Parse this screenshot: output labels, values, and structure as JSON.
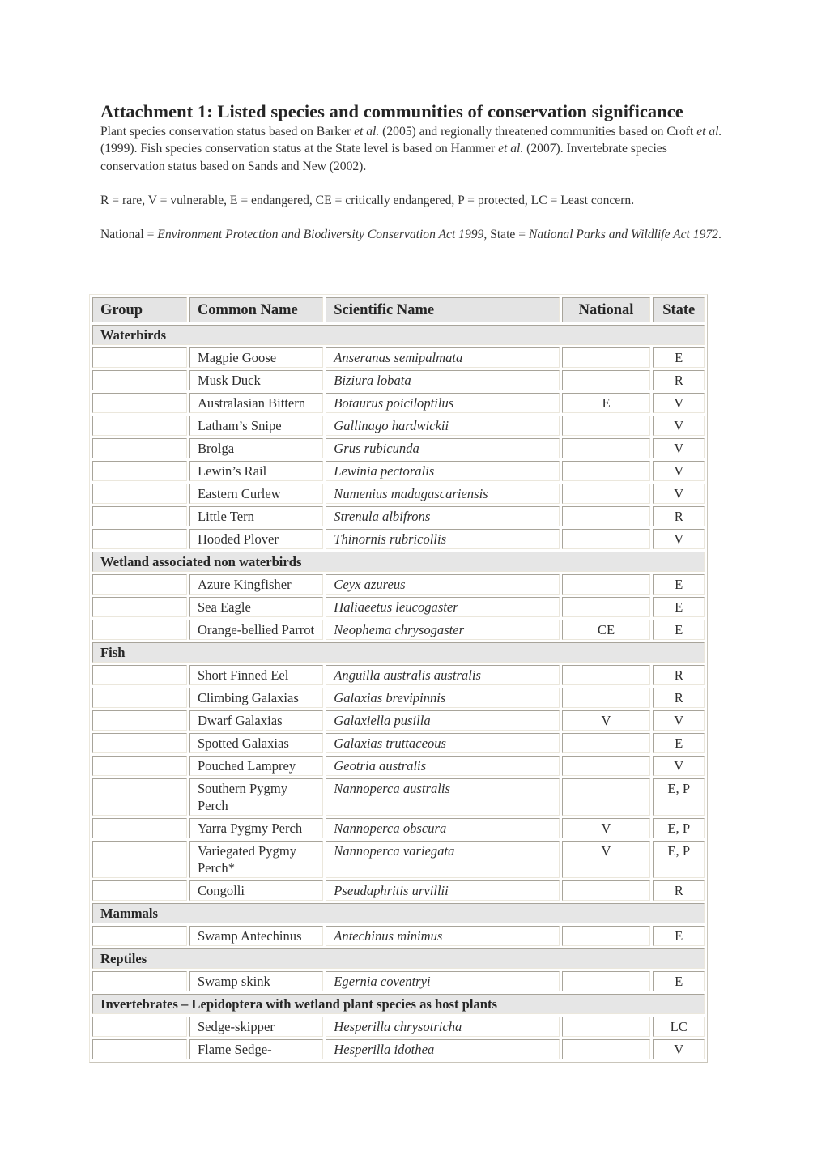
{
  "title": "Attachment 1: Listed species and communities of conservation significance",
  "intro": {
    "parts": [
      {
        "text": "Plant species conservation status based on Barker ",
        "italic": false
      },
      {
        "text": "et al.",
        "italic": true
      },
      {
        "text": " (2005) and regionally threatened communities based on Croft ",
        "italic": false
      },
      {
        "text": "et al.",
        "italic": true
      },
      {
        "text": " (1999). Fish species conservation status at the State level is based on Hammer ",
        "italic": false
      },
      {
        "text": "et al.",
        "italic": true
      },
      {
        "text": " (2007). Invertebrate species conservation status based on Sands and New (2002).",
        "italic": false
      }
    ]
  },
  "legend": "R = rare, V = vulnerable, E = endangered, CE = critically endangered, P = protected, LC = Least concern.",
  "acts": {
    "parts": [
      {
        "text": "National = ",
        "italic": false
      },
      {
        "text": "Environment Protection and Biodiversity Conservation Act 1999",
        "italic": true
      },
      {
        "text": ", State = ",
        "italic": false
      },
      {
        "text": "National Parks and Wildlife Act 1972",
        "italic": true
      },
      {
        "text": ".",
        "italic": false
      }
    ]
  },
  "table": {
    "headers": [
      "Group",
      "Common Name",
      "Scientific Name",
      "National",
      "State"
    ],
    "groups": [
      {
        "name": "Waterbirds",
        "rows": [
          {
            "common": "Magpie Goose",
            "scientific": "Anseranas semipalmata",
            "national": "",
            "state": "E"
          },
          {
            "common": "Musk Duck",
            "scientific": "Biziura lobata",
            "national": "",
            "state": "R"
          },
          {
            "common": "Australasian Bittern",
            "scientific": "Botaurus poiciloptilus",
            "national": "E",
            "state": "V"
          },
          {
            "common": "Latham’s Snipe",
            "scientific": "Gallinago hardwickii",
            "national": "",
            "state": "V"
          },
          {
            "common": "Brolga",
            "scientific": "Grus rubicunda",
            "national": "",
            "state": "V"
          },
          {
            "common": "Lewin’s Rail",
            "scientific": "Lewinia pectoralis",
            "national": "",
            "state": "V"
          },
          {
            "common": "Eastern Curlew",
            "scientific": "Numenius madagascariensis",
            "national": "",
            "state": "V"
          },
          {
            "common": "Little Tern",
            "scientific": "Strenula albifrons",
            "national": "",
            "state": "R"
          },
          {
            "common": "Hooded Plover",
            "scientific": "Thinornis rubricollis",
            "national": "",
            "state": "V"
          }
        ]
      },
      {
        "name": "Wetland associated non waterbirds",
        "rows": [
          {
            "common": "Azure Kingfisher",
            "scientific": "Ceyx azureus",
            "national": "",
            "state": "E"
          },
          {
            "common": "Sea Eagle",
            "scientific": "Haliaeetus leucogaster",
            "national": "",
            "state": "E"
          },
          {
            "common": "Orange-bellied Parrot",
            "scientific": "Neophema chrysogaster",
            "national": "CE",
            "state": "E"
          }
        ]
      },
      {
        "name": "Fish",
        "rows": [
          {
            "common": "Short Finned Eel",
            "scientific": "Anguilla australis australis",
            "national": "",
            "state": "R"
          },
          {
            "common": "Climbing Galaxias",
            "scientific": "Galaxias brevipinnis",
            "national": "",
            "state": "R"
          },
          {
            "common": "Dwarf Galaxias",
            "scientific": "Galaxiella pusilla",
            "national": "V",
            "state": "V"
          },
          {
            "common": "Spotted Galaxias",
            "scientific": "Galaxias truttaceous",
            "national": "",
            "state": "E"
          },
          {
            "common": "Pouched Lamprey",
            "scientific": "Geotria australis",
            "national": "",
            "state": "V"
          },
          {
            "common": "Southern Pygmy Perch",
            "scientific": "Nannoperca australis",
            "national": "",
            "state": "E, P"
          },
          {
            "common": "Yarra Pygmy Perch",
            "scientific": "Nannoperca obscura",
            "national": "V",
            "state": "E, P"
          },
          {
            "common": "Variegated Pygmy Perch*",
            "scientific": "Nannoperca variegata",
            "national": "V",
            "state": "E, P"
          },
          {
            "common": "Congolli",
            "scientific": "Pseudaphritis urvillii",
            "national": "",
            "state": "R"
          }
        ]
      },
      {
        "name": "Mammals",
        "rows": [
          {
            "common": "Swamp Antechinus",
            "scientific": "Antechinus minimus",
            "national": "",
            "state": "E"
          }
        ]
      },
      {
        "name": "Reptiles",
        "rows": [
          {
            "common": "Swamp skink",
            "scientific": "Egernia coventryi",
            "national": "",
            "state": "E"
          }
        ]
      },
      {
        "name": "Invertebrates – Lepidoptera with wetland plant species as host plants",
        "rows": [
          {
            "common": "Sedge-skipper",
            "scientific": "Hesperilla chrysotricha",
            "national": "",
            "state": "LC"
          },
          {
            "common": "Flame Sedge-",
            "scientific": "Hesperilla idothea",
            "national": "",
            "state": "V"
          }
        ]
      }
    ]
  }
}
